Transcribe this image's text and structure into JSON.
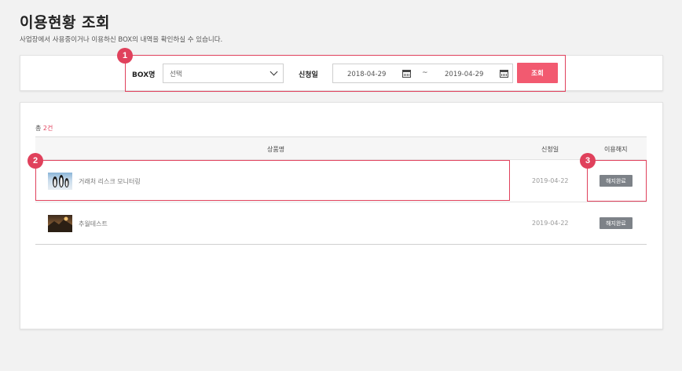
{
  "page": {
    "title": "이용현황 조회",
    "description": "사업장에서 사용중이거나 이용하신 BOX의 내역을 확인하실 수 있습니다."
  },
  "search": {
    "box_label": "BOX명",
    "box_select_value": "선택",
    "date_label": "신청일",
    "date_from": "2018-04-29",
    "date_separator": "~",
    "date_to": "2019-04-29",
    "search_button": "조회"
  },
  "markers": [
    "1",
    "2",
    "3"
  ],
  "results": {
    "total_prefix": "총",
    "total_count": "2건",
    "columns": {
      "name": "상품명",
      "date": "신청일",
      "cancel": "이용해지"
    },
    "rows": [
      {
        "name": "거래처 리스크 모니터링",
        "date": "2019-04-22",
        "action": "해지완료",
        "thumb": "penguins-image"
      },
      {
        "name": "추월테스트",
        "date": "2019-04-22",
        "action": "해지완료",
        "thumb": "landscape-image"
      }
    ]
  },
  "colors": {
    "accent": "#e0415c",
    "search_button": "#f25a70",
    "cancel_button": "#7d8288"
  },
  "icons": {
    "select": "chevron-down-icon",
    "date": "calendar-icon"
  }
}
